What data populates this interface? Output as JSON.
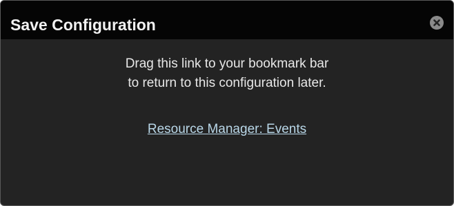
{
  "dialog": {
    "title": "Save Configuration",
    "close_icon": "close-icon",
    "message_line_1": "Drag this link to your bookmark bar",
    "message_line_2": "to return to this configuration later.",
    "link_text": "Resource Manager: Events"
  },
  "colors": {
    "titlebar_background": "#050505",
    "body_background": "#232323",
    "text": "#e8e8e8",
    "link": "#b9d7e8",
    "close_button": "#8a8a8a"
  }
}
